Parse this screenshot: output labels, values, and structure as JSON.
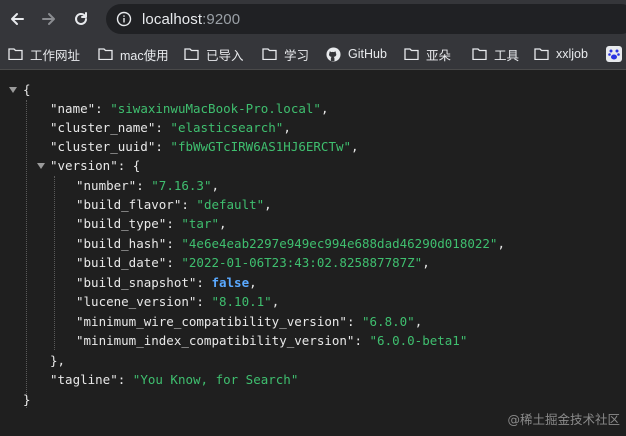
{
  "browser": {
    "url_host": "localhost",
    "url_port": ":9200"
  },
  "bookmarks": [
    {
      "label": "工作网址",
      "icon": "folder-icon"
    },
    {
      "label": "mac使用",
      "icon": "folder-icon"
    },
    {
      "label": "已导入",
      "icon": "folder-icon"
    },
    {
      "label": "学习",
      "icon": "folder-icon"
    },
    {
      "label": "GitHub",
      "icon": "github-icon"
    },
    {
      "label": "亚朵",
      "icon": "folder-icon"
    },
    {
      "label": "工具",
      "icon": "folder-icon"
    },
    {
      "label": "xxljob",
      "icon": "folder-icon"
    }
  ],
  "json": {
    "name_key": "\"name\"",
    "name_val": "\"siwaxinwuMacBook-Pro.local\"",
    "cluster_name_key": "\"cluster_name\"",
    "cluster_name_val": "\"elasticsearch\"",
    "cluster_uuid_key": "\"cluster_uuid\"",
    "cluster_uuid_val": "\"fbWwGTcIRW6AS1HJ6ERCTw\"",
    "version_key": "\"version\"",
    "number_key": "\"number\"",
    "number_val": "\"7.16.3\"",
    "build_flavor_key": "\"build_flavor\"",
    "build_flavor_val": "\"default\"",
    "build_type_key": "\"build_type\"",
    "build_type_val": "\"tar\"",
    "build_hash_key": "\"build_hash\"",
    "build_hash_val": "\"4e6e4eab2297e949ec994e688dad46290d018022\"",
    "build_date_key": "\"build_date\"",
    "build_date_val": "\"2022-01-06T23:43:02.825887787Z\"",
    "build_snapshot_key": "\"build_snapshot\"",
    "build_snapshot_val": "false",
    "lucene_version_key": "\"lucene_version\"",
    "lucene_version_val": "\"8.10.1\"",
    "min_wire_key": "\"minimum_wire_compatibility_version\"",
    "min_wire_val": "\"6.8.0\"",
    "min_index_key": "\"minimum_index_compatibility_version\"",
    "min_index_val": "\"6.0.0-beta1\"",
    "tagline_key": "\"tagline\"",
    "tagline_val": "\"You Know, for Search\""
  },
  "watermark": "@稀土掘金技术社区",
  "colors": {
    "string": "#3fbf6f",
    "boolean": "#5aa9ff",
    "background": "#1f1f1f",
    "toolbar": "#35363a"
  }
}
